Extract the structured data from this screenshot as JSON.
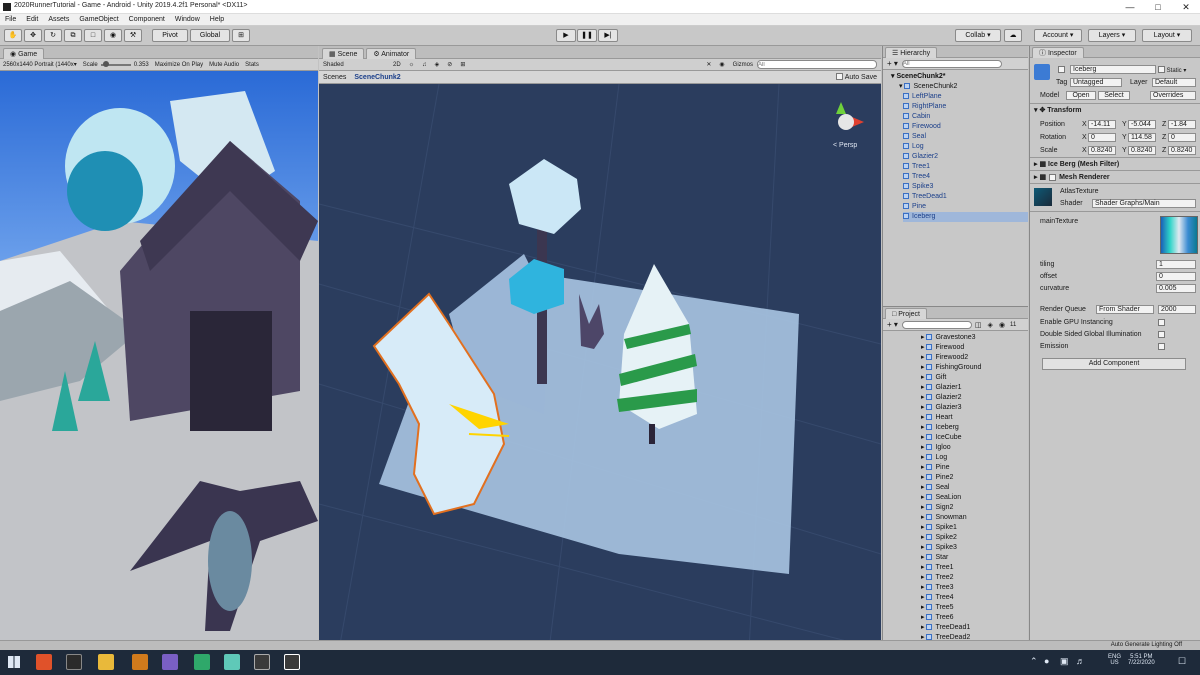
{
  "window": {
    "title": "2020RunnerTutorial - Game - Android - Unity 2019.4.2f1 Personal* <DX11>"
  },
  "menu": [
    "File",
    "Edit",
    "Assets",
    "GameObject",
    "Component",
    "Window",
    "Help"
  ],
  "toolbar": {
    "pivot": "Pivot",
    "global": "Global",
    "collab": "Collab ▾",
    "account": "Account ▾",
    "layers": "Layers ▾",
    "layout": "Layout ▾"
  },
  "game": {
    "tab": "Game",
    "resolution": "2560x1440 Portrait (1440x▾",
    "scale_label": "Scale",
    "scale_value": "0.353",
    "maximize": "Maximize On Play",
    "mute": "Mute Audio",
    "stats": "Stats"
  },
  "scene": {
    "tab_scene": "Scene",
    "tab_animator": "Animator",
    "shading": "Shaded",
    "mode_2d": "2D",
    "gizmos": "Gizmos",
    "search_placeholder": "All",
    "breadcrumb_root": "Scenes",
    "breadcrumb_current": "SceneChunk2",
    "autosave": "Auto Save",
    "persp": "< Persp"
  },
  "hierarchy": {
    "tab": "Hierarchy",
    "search_placeholder": "All",
    "root": "SceneChunk2*",
    "child_root": "SceneChunk2",
    "items": [
      "LeftPlane",
      "RightPlane",
      "Cabin",
      "Firewood",
      "Seal",
      "Log",
      "Glazier2",
      "Tree1",
      "Tree4",
      "Spike3",
      "TreeDead1",
      "Pine",
      "Iceberg"
    ]
  },
  "project": {
    "tab": "Project",
    "count": "11",
    "items": [
      "Gravestone3",
      "Firewood",
      "Firewood2",
      "FishingGround",
      "Gift",
      "Glazier1",
      "Glazier2",
      "Glazier3",
      "Heart",
      "Iceberg",
      "IceCube",
      "Igloo",
      "Log",
      "Pine",
      "Pine2",
      "Seal",
      "SeaLion",
      "Sign2",
      "Snowman",
      "Spike1",
      "Spike2",
      "Spike3",
      "Star",
      "Tree1",
      "Tree2",
      "Tree3",
      "Tree4",
      "Tree5",
      "Tree6",
      "TreeDead1",
      "TreeDead2"
    ]
  },
  "inspector": {
    "tab": "Inspector",
    "name": "Iceberg",
    "static": "Static ▾",
    "tag_label": "Tag",
    "tag_value": "Untagged",
    "layer_label": "Layer",
    "layer_value": "Default",
    "model_label": "Model",
    "open": "Open",
    "select": "Select",
    "overrides": "Overrides",
    "transform": {
      "title": "Transform",
      "position_label": "Position",
      "rotation_label": "Rotation",
      "scale_label": "Scale",
      "position": {
        "x": "-14.11",
        "y": "-5.044",
        "z": "-1.84"
      },
      "rotation": {
        "x": "0",
        "y": "114.58",
        "z": "0"
      },
      "scale": {
        "x": "0.8240",
        "y": "0.8240",
        "z": "0.8240"
      }
    },
    "mesh_filter": "Ice Berg (Mesh Filter)",
    "mesh_renderer": "Mesh Renderer",
    "material": {
      "name": "AtlasTexture",
      "shader_label": "Shader",
      "shader_value": "Shader Graphs/Main"
    },
    "props": {
      "main_texture": "mainTexture",
      "tiling_label": "tiling",
      "tiling_value": "1",
      "offset_label": "offset",
      "offset_value": "0",
      "curvature_label": "curvature",
      "curvature_value": "0.005"
    },
    "render_queue_label": "Render Queue",
    "render_queue_mode": "From Shader",
    "render_queue_value": "2000",
    "gpu_instancing": "Enable GPU Instancing",
    "double_sided": "Double Sided Global Illumination",
    "emission": "Emission",
    "add_component": "Add Component"
  },
  "status": {
    "lighting": "Auto Generate Lighting Off"
  },
  "tray": {
    "lang": "ENG",
    "locale": "US",
    "time": "5:51 PM",
    "date": "7/22/2020"
  }
}
